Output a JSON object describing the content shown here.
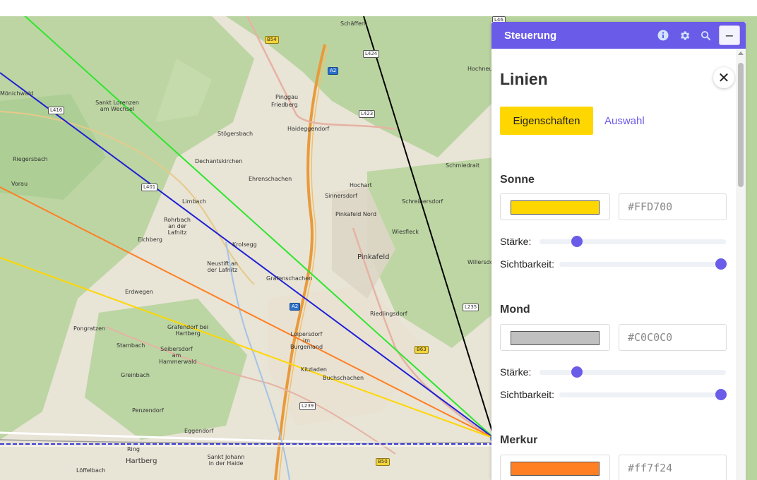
{
  "map": {
    "labels": [
      "Schäffern",
      "Hochneukirchen",
      "Mönichwald",
      "Sankt Lorenzen am Wechsel",
      "Pinggau",
      "Friedberg",
      "Haideggendorf",
      "Stögersbach",
      "Dechantskirchen",
      "Riegersbach",
      "Vorau",
      "Ehrenschachen",
      "Hochart",
      "Schmiedrait",
      "Sinnersdorf",
      "Schreibersdorf",
      "Limbach",
      "Pinkafeld Nord",
      "Rohrbach an der Lafnitz",
      "Wiesfleck",
      "Eichberg",
      "Krolsegg",
      "Neustift an der Lafnitz",
      "Pinkafeld",
      "Willersdorf",
      "Grafenschachen",
      "Erdwegen",
      "Riedlingsdorf",
      "Pongratzen",
      "Grafendorf bei Hartberg",
      "Stambach",
      "Seibersdorf am Hammerwald",
      "Loipersdorf im Burgenland",
      "Kitzladen",
      "Buchschachen",
      "Greinbach",
      "Penzendorf",
      "Eggendorf",
      "Ring",
      "Hartberg",
      "Sankt Johann in der Haide",
      "Löffelbach"
    ],
    "road_shields": [
      "B54",
      "L424",
      "A2",
      "L416",
      "L423",
      "L401",
      "L235",
      "A2",
      "B63",
      "L239",
      "B50",
      "L46"
    ]
  },
  "panel": {
    "title": "Steuerung",
    "icons": [
      "info-icon",
      "gear-icon",
      "search-icon"
    ],
    "minimize_symbol": "−",
    "heading": "Linien",
    "close_symbol": "✕",
    "tabs": [
      {
        "label": "Eigenschaften",
        "active": true
      },
      {
        "label": "Auswahl",
        "active": false
      }
    ],
    "sections": [
      {
        "title": "Sonne",
        "color": "#FFD700",
        "hex": "#FFD700",
        "strength_label": "Stärke:",
        "visibility_label": "Sichtbarkeit:",
        "strength": 0.2,
        "visibility": 1.0
      },
      {
        "title": "Mond",
        "color": "#C0C0C0",
        "hex": "#C0C0C0",
        "strength_label": "Stärke:",
        "visibility_label": "Sichtbarkeit:",
        "strength": 0.2,
        "visibility": 1.0
      },
      {
        "title": "Merkur",
        "color": "#ff7f24",
        "hex": "#ff7f24"
      }
    ]
  },
  "colors": {
    "accent": "#6a5be8",
    "sun_line": "#FFD700",
    "moon_line": "#000000",
    "mercury_line": "#ff7f24"
  }
}
